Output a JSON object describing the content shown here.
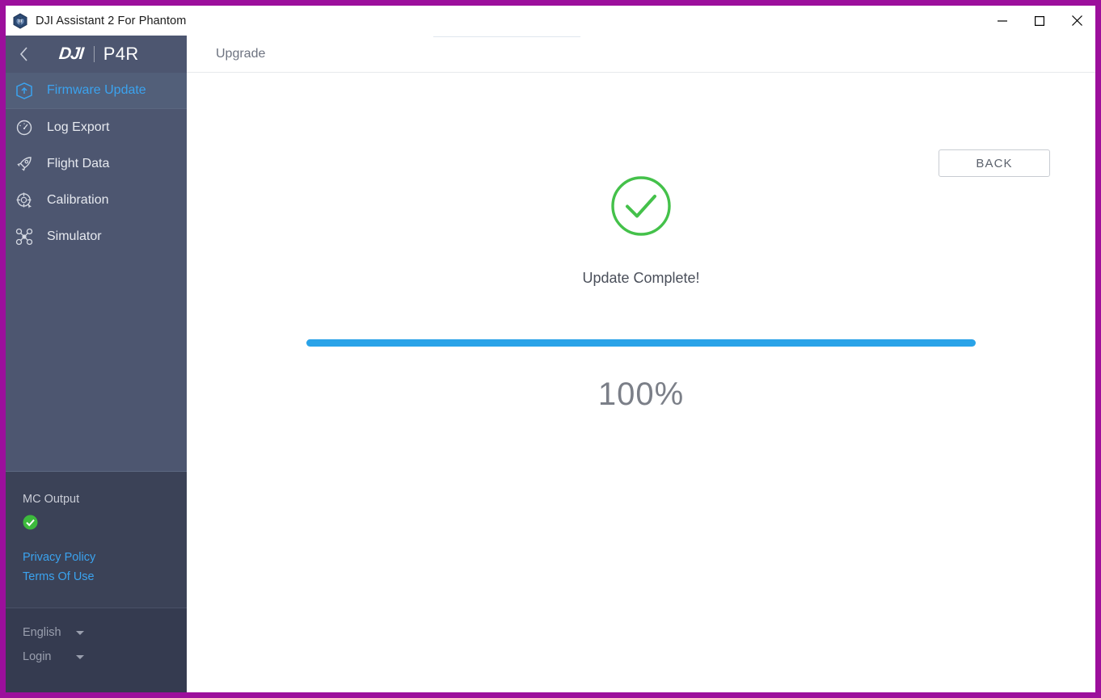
{
  "window": {
    "title": "DJI Assistant 2 For Phantom",
    "app_icon": "drone-hex-icon",
    "controls": {
      "minimize": "minimize-icon",
      "maximize": "maximize-icon",
      "close": "close-icon"
    },
    "frame_color": "#9c0f9c"
  },
  "sidebar": {
    "back_icon": "chevron-left-icon",
    "brand": "DJI",
    "model": "P4R",
    "items": [
      {
        "label": "Firmware Update",
        "icon": "firmware-update-icon",
        "active": true
      },
      {
        "label": "Log Export",
        "icon": "gauge-icon",
        "active": false
      },
      {
        "label": "Flight Data",
        "icon": "rocket-icon",
        "active": false
      },
      {
        "label": "Calibration",
        "icon": "crosshair-icon",
        "active": false
      },
      {
        "label": "Simulator",
        "icon": "drone-icon",
        "active": false
      }
    ],
    "status": {
      "label": "MC Output",
      "badge_icon": "check-circle-icon",
      "badge_color": "#3dba3d"
    },
    "links": [
      {
        "label": "Privacy Policy"
      },
      {
        "label": "Terms Of Use"
      }
    ],
    "footer": {
      "language": "English",
      "account": "Login",
      "caret_icon": "caret-down-icon"
    },
    "colors": {
      "base": "#4d5670",
      "active": "#525f79",
      "status_panel": "#3b4257",
      "footer_panel": "#353b50",
      "link": "#3ba3ef"
    }
  },
  "main": {
    "tab": "Upgrade",
    "back_button": "BACK",
    "result": {
      "icon": "check-circle-outline-icon",
      "icon_color": "#44c14a",
      "message": "Update Complete!"
    },
    "progress": {
      "percent": 100,
      "percent_label": "100%",
      "bar_color": "#2aa3e8"
    }
  }
}
